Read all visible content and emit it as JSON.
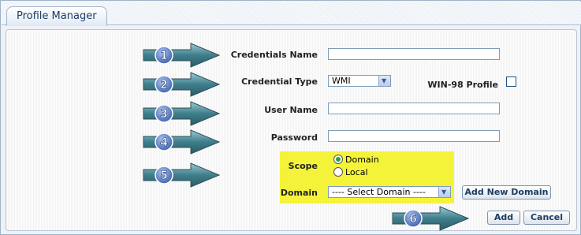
{
  "window": {
    "tab_label": "Profile Manager"
  },
  "steps": [
    "1",
    "2",
    "3",
    "4",
    "5",
    "6"
  ],
  "form": {
    "credentials_name_label": "Credentials Name",
    "credentials_name_value": "",
    "credential_type_label": "Credential Type",
    "credential_type_selected": "WMI",
    "win98_label": "WIN-98 Profile",
    "win98_checked": false,
    "user_name_label": "User Name",
    "user_name_value": "",
    "password_label": "Password",
    "password_value": "",
    "scope_label": "Scope",
    "scope_options": [
      "Domain",
      "Local"
    ],
    "scope_selected": "Domain",
    "domain_label": "Domain",
    "domain_selected": "---- Select Domain ----",
    "add_domain_button": "Add New Domain"
  },
  "actions": {
    "add_button": "Add",
    "cancel_button": "Cancel"
  },
  "colors": {
    "highlight": "#f4f33a",
    "arrow_fill": "#3f7e8c",
    "step_badge": "#3c5fae"
  }
}
